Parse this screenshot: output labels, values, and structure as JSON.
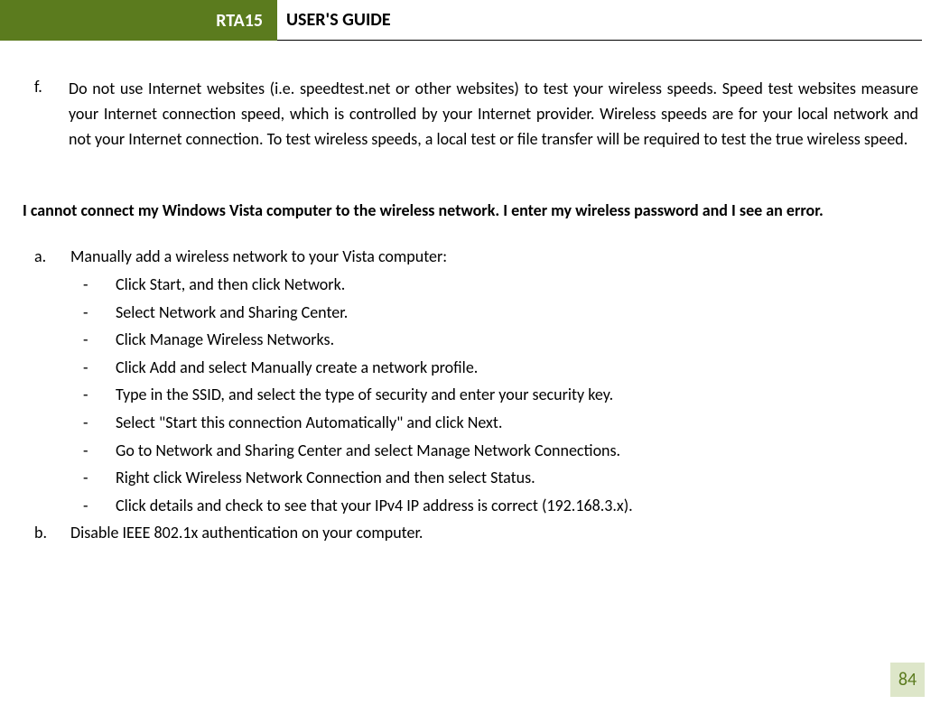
{
  "header": {
    "badge": "RTA15",
    "title": "USER'S GUIDE"
  },
  "item_f": {
    "marker": "f.",
    "text": "Do not use Internet websites (i.e. speedtest.net or other websites) to test your wireless speeds.  Speed test websites measure your Internet connection speed, which is controlled by your Internet provider.  Wireless speeds are for your local network and not your Internet connection.  To test wireless speeds, a local test or file transfer will be required to test the true wireless speed."
  },
  "heading": "I cannot connect my Windows Vista computer to the wireless network.  I enter my wireless password and I see an error.",
  "item_a": {
    "marker": "a.",
    "text": "Manually add a wireless network to your Vista computer:"
  },
  "sub": [
    "Click Start, and then click Network.",
    "Select Network and Sharing Center.",
    "Click Manage Wireless Networks.",
    "Click Add and select Manually create a network profile.",
    "Type in the SSID, and select the type of security and enter your security key.",
    "Select \"Start this connection Automatically\" and click Next.",
    "Go to Network and Sharing Center and select Manage Network Connections.",
    "Right click Wireless Network Connection and then select Status.",
    "Click details and check to see that your IPv4 IP address is correct (192.168.3.x)."
  ],
  "dash": "-",
  "item_b": {
    "marker": "b.",
    "text": "Disable IEEE 802.1x authentication on your computer."
  },
  "page_number": "84"
}
